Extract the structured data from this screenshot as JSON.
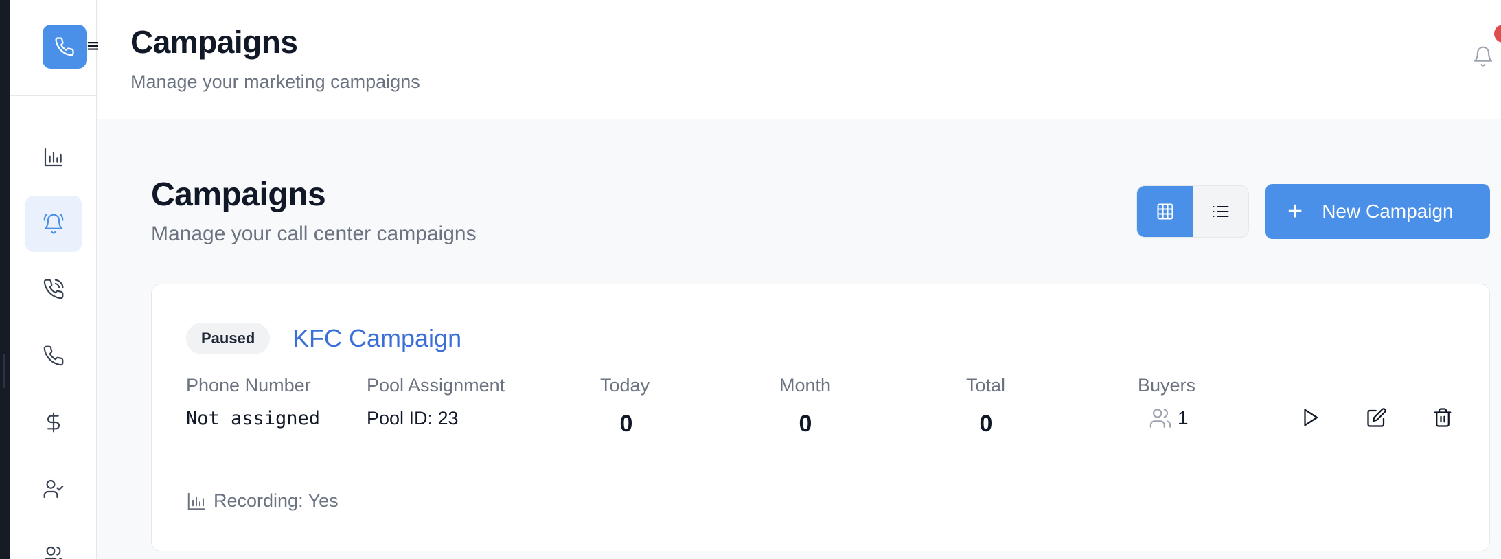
{
  "header": {
    "title": "Campaigns",
    "subtitle": "Manage your marketing campaigns"
  },
  "sidebar": {
    "menu_glyph": "≡",
    "items": [
      {
        "icon": "bar-chart-icon",
        "active": false
      },
      {
        "icon": "bell-ring-icon",
        "active": true
      },
      {
        "icon": "phone-call-icon",
        "active": false
      },
      {
        "icon": "phone-icon",
        "active": false
      },
      {
        "icon": "dollar-icon",
        "active": false
      },
      {
        "icon": "user-check-icon",
        "active": false
      },
      {
        "icon": "users-icon",
        "active": false
      }
    ]
  },
  "main": {
    "title": "Campaigns",
    "subtitle": "Manage your call center campaigns",
    "new_campaign_label": "New Campaign",
    "view_mode": "grid"
  },
  "campaign": {
    "status": "Paused",
    "name": "KFC Campaign",
    "labels": {
      "phone": "Phone Number",
      "pool": "Pool Assignment",
      "today": "Today",
      "month": "Month",
      "total": "Total",
      "buyers": "Buyers"
    },
    "phone": "Not assigned",
    "pool": "Pool ID: 23",
    "today": "0",
    "month": "0",
    "total": "0",
    "buyers": "1",
    "recording": "Recording: Yes"
  },
  "colors": {
    "accent": "#4a90e8",
    "link": "#3b6fd8",
    "notification": "#e04b4b"
  }
}
